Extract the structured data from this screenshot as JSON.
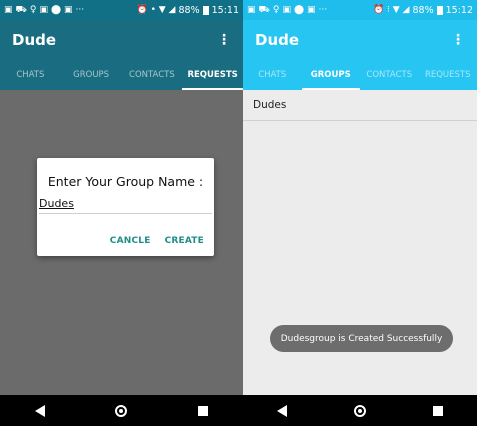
{
  "left": {
    "status": {
      "icons": [
        "▣",
        "⛟",
        "♀",
        "▣",
        "⬤",
        "▣"
      ],
      "overflow": "···",
      "right_icons": "⏰ • ▼ ◢",
      "battery": "88%",
      "time": "15:11"
    },
    "appbar": {
      "title": "Dude",
      "menu": "⋮"
    },
    "tabs": [
      "CHATS",
      "GROUPS",
      "CONTACTS",
      "REQUESTS"
    ],
    "dialog": {
      "title": "Enter Your Group Name :",
      "input_value": "Dudes",
      "cancel": "CANCLE",
      "create": "CREATE"
    }
  },
  "right": {
    "status": {
      "icons": [
        "▣",
        "⛟",
        "♀",
        "▣",
        "⬤",
        "▣"
      ],
      "overflow": "···",
      "right_icons": "⏰ ⁝ ▼ ◢",
      "battery": "88%",
      "time": "15:12"
    },
    "appbar": {
      "title": "Dude",
      "menu": "⋮"
    },
    "tabs": [
      "CHATS",
      "GROUPS",
      "CONTACTS",
      "REQUESTS"
    ],
    "groups": [
      {
        "name": "Dudes"
      }
    ],
    "toast": "Dudesgroup is Created Successfully"
  },
  "colors": {
    "left_primary": "#1a6d80",
    "right_primary": "#27c5f2",
    "accent": "#1f8d8a"
  }
}
